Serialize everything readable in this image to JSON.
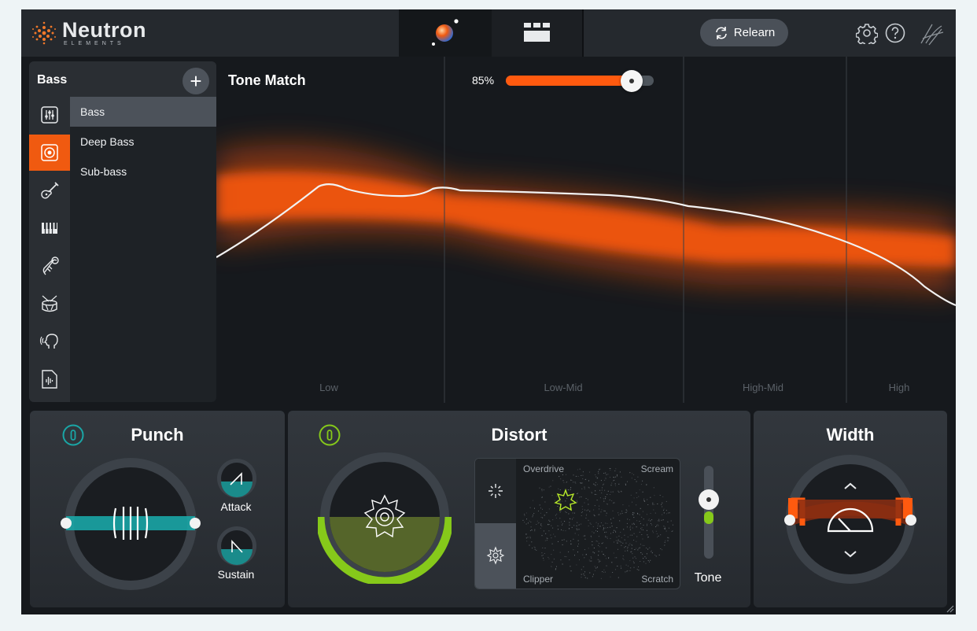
{
  "brand": {
    "name": "Neutron",
    "subtitle": "ELEMENTS"
  },
  "topbar": {
    "tabs": [
      {
        "icon": "visual-mixer-orb-icon",
        "active": true
      },
      {
        "icon": "mixer-grid-icon",
        "active": false
      }
    ],
    "relearn_label": "Relearn",
    "icons": [
      "gear-icon",
      "help-icon",
      "signature-icon"
    ]
  },
  "sidebar": {
    "title": "Bass",
    "add_label": "+",
    "categories": [
      "eq-sliders-icon",
      "speaker-icon",
      "guitar-icon",
      "piano-keys-icon",
      "horn-icon",
      "drum-icon",
      "voice-icon",
      "audio-file-icon"
    ],
    "active_category": 1,
    "targets": [
      "Bass",
      "Deep Bass",
      "Sub-bass"
    ],
    "selected_target": 0
  },
  "tone_match": {
    "title": "Tone Match",
    "amount_label": "85%",
    "amount": 0.85,
    "bands": [
      "Low",
      "Low-Mid",
      "High-Mid",
      "High"
    ]
  },
  "punch": {
    "title": "Punch",
    "attack_label": "Attack",
    "sustain_label": "Sustain",
    "enabled": true
  },
  "distort": {
    "title": "Distort",
    "enabled": true,
    "corners": {
      "top_left": "Overdrive",
      "top_right": "Scream",
      "bottom_left": "Clipper",
      "bottom_right": "Scratch"
    },
    "tone_label": "Tone"
  },
  "width": {
    "title": "Width"
  },
  "colors": {
    "accent": "#ff5a0f",
    "punch": "#1aa6a6",
    "distort": "#86c91a"
  }
}
